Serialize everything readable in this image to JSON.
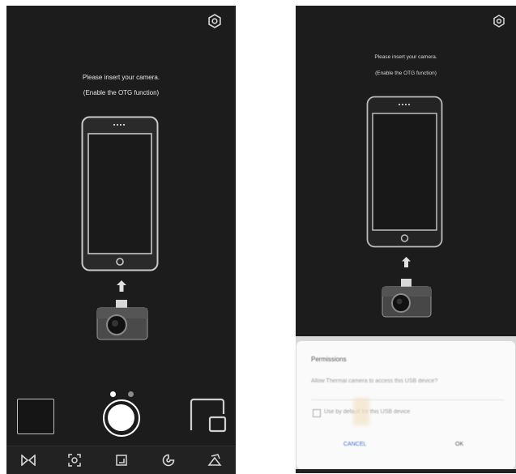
{
  "left_screen": {
    "message_line1": "Please insert your camera.",
    "message_line2": "(Enable the OTG function)",
    "settings_icon": "gear-icon",
    "phone_icon": "phone-icon",
    "arrow_icon": "arrow-up-icon",
    "camera_icon": "thermal-camera-icon",
    "mode_dots_active": 0,
    "bottom_icons": [
      "compare-icon",
      "scan-icon",
      "crop-icon",
      "palette-icon",
      "tools-icon"
    ]
  },
  "right_screen": {
    "message_line1": "Please insert your camera.",
    "message_line2": "(Enable the OTG function)",
    "settings_icon": "gear-icon",
    "dialog": {
      "title": "Permissions",
      "body": "Allow Thermal camera to access this USB device?",
      "checkbox_text": "Use by default for this USB device",
      "cancel_label": "CANCEL",
      "ok_label": "OK"
    }
  },
  "colors": {
    "screen_bg": "#1c1c1c",
    "text": "#e6e6e6",
    "outline": "#bfbfbf",
    "dialog_bg": "#fafafa",
    "accent": "#3b6fd6"
  }
}
